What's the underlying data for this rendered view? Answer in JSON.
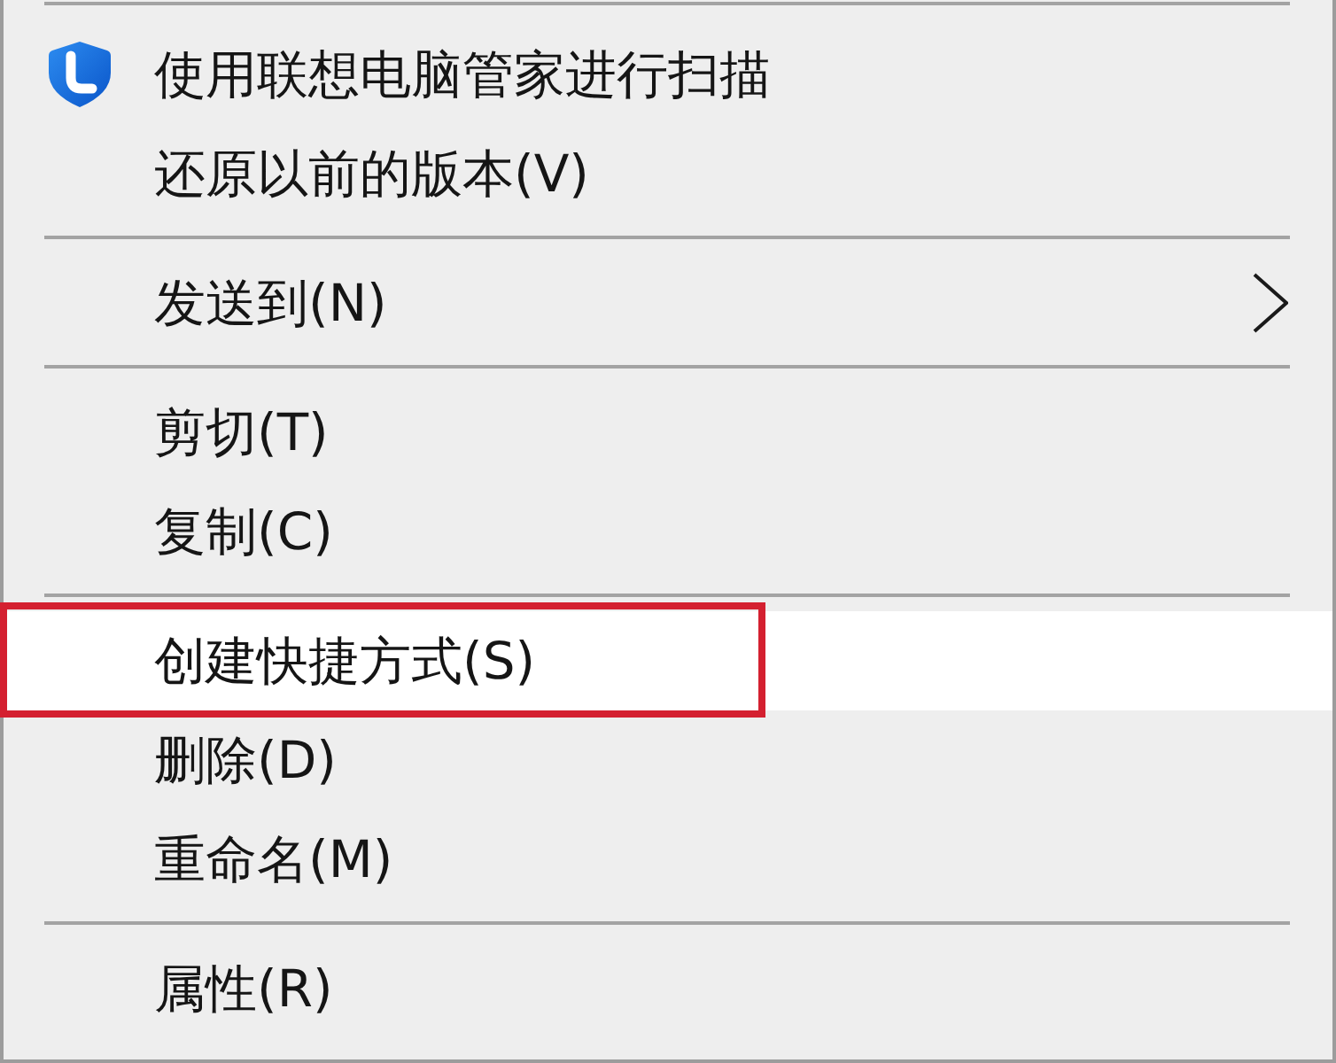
{
  "menu": {
    "sections": [
      {
        "items": [
          {
            "label": "使用联想电脑管家进行扫描",
            "has_icon": true,
            "submenu": false,
            "selected": false,
            "outlined": false
          },
          {
            "label": "还原以前的版本(V)",
            "has_icon": false,
            "submenu": false,
            "selected": false,
            "outlined": false
          }
        ]
      },
      {
        "items": [
          {
            "label": "发送到(N)",
            "has_icon": false,
            "submenu": true,
            "selected": false,
            "outlined": false
          }
        ]
      },
      {
        "items": [
          {
            "label": "剪切(T)",
            "has_icon": false,
            "submenu": false,
            "selected": false,
            "outlined": false
          },
          {
            "label": "复制(C)",
            "has_icon": false,
            "submenu": false,
            "selected": false,
            "outlined": false
          }
        ]
      },
      {
        "items": [
          {
            "label": "创建快捷方式(S)",
            "has_icon": false,
            "submenu": false,
            "selected": true,
            "outlined": true
          },
          {
            "label": "删除(D)",
            "has_icon": false,
            "submenu": false,
            "selected": false,
            "outlined": false
          },
          {
            "label": "重命名(M)",
            "has_icon": false,
            "submenu": false,
            "selected": false,
            "outlined": false
          }
        ]
      },
      {
        "items": [
          {
            "label": "属性(R)",
            "has_icon": false,
            "submenu": false,
            "selected": false,
            "outlined": false
          }
        ]
      }
    ]
  }
}
